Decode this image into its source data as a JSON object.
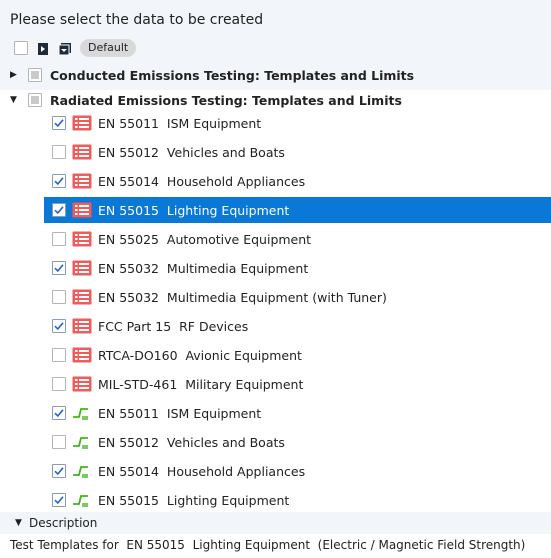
{
  "header": {
    "prompt": "Please select the data to be created",
    "default_label": "Default"
  },
  "groups": [
    {
      "label": "Conducted Emissions Testing: Templates and Limits",
      "expanded": false
    },
    {
      "label": "Radiated Emissions Testing: Templates and Limits",
      "expanded": true
    }
  ],
  "items": [
    {
      "label": "EN 55011  ISM Equipment",
      "checked": true,
      "icon": "list-icon",
      "selected": false
    },
    {
      "label": "EN 55012  Vehicles and Boats",
      "checked": false,
      "icon": "list-icon",
      "selected": false
    },
    {
      "label": "EN 55014  Household Appliances",
      "checked": true,
      "icon": "list-icon",
      "selected": false
    },
    {
      "label": "EN 55015  Lighting Equipment",
      "checked": true,
      "icon": "list-icon",
      "selected": true
    },
    {
      "label": "EN 55025  Automotive Equipment",
      "checked": false,
      "icon": "list-icon",
      "selected": false
    },
    {
      "label": "EN 55032  Multimedia Equipment",
      "checked": true,
      "icon": "list-icon",
      "selected": false
    },
    {
      "label": "EN 55032  Multimedia Equipment (with Tuner)",
      "checked": false,
      "icon": "list-icon",
      "selected": false
    },
    {
      "label": "FCC Part 15  RF Devices",
      "checked": true,
      "icon": "list-icon",
      "selected": false
    },
    {
      "label": "RTCA-DO160  Avionic Equipment",
      "checked": false,
      "icon": "list-icon",
      "selected": false
    },
    {
      "label": "MIL-STD-461  Military Equipment",
      "checked": false,
      "icon": "list-icon",
      "selected": false
    },
    {
      "label": "EN 55011  ISM Equipment",
      "checked": true,
      "icon": "limit-line-icon",
      "selected": false
    },
    {
      "label": "EN 55012  Vehicles and Boats",
      "checked": false,
      "icon": "limit-line-icon",
      "selected": false
    },
    {
      "label": "EN 55014  Household Appliances",
      "checked": true,
      "icon": "limit-line-icon",
      "selected": false
    },
    {
      "label": "EN 55015  Lighting Equipment",
      "checked": true,
      "icon": "limit-line-icon",
      "selected": false
    }
  ],
  "description": {
    "title": "Description",
    "text": "Test Templates for  EN 55015  Lighting Equipment  (Electric / Magnetic Field Strength)"
  },
  "colors": {
    "selection": "#0a78d7",
    "list_icon": "#f25b5b",
    "limit_icon": "#3fb618",
    "check": "#1f66cc"
  }
}
